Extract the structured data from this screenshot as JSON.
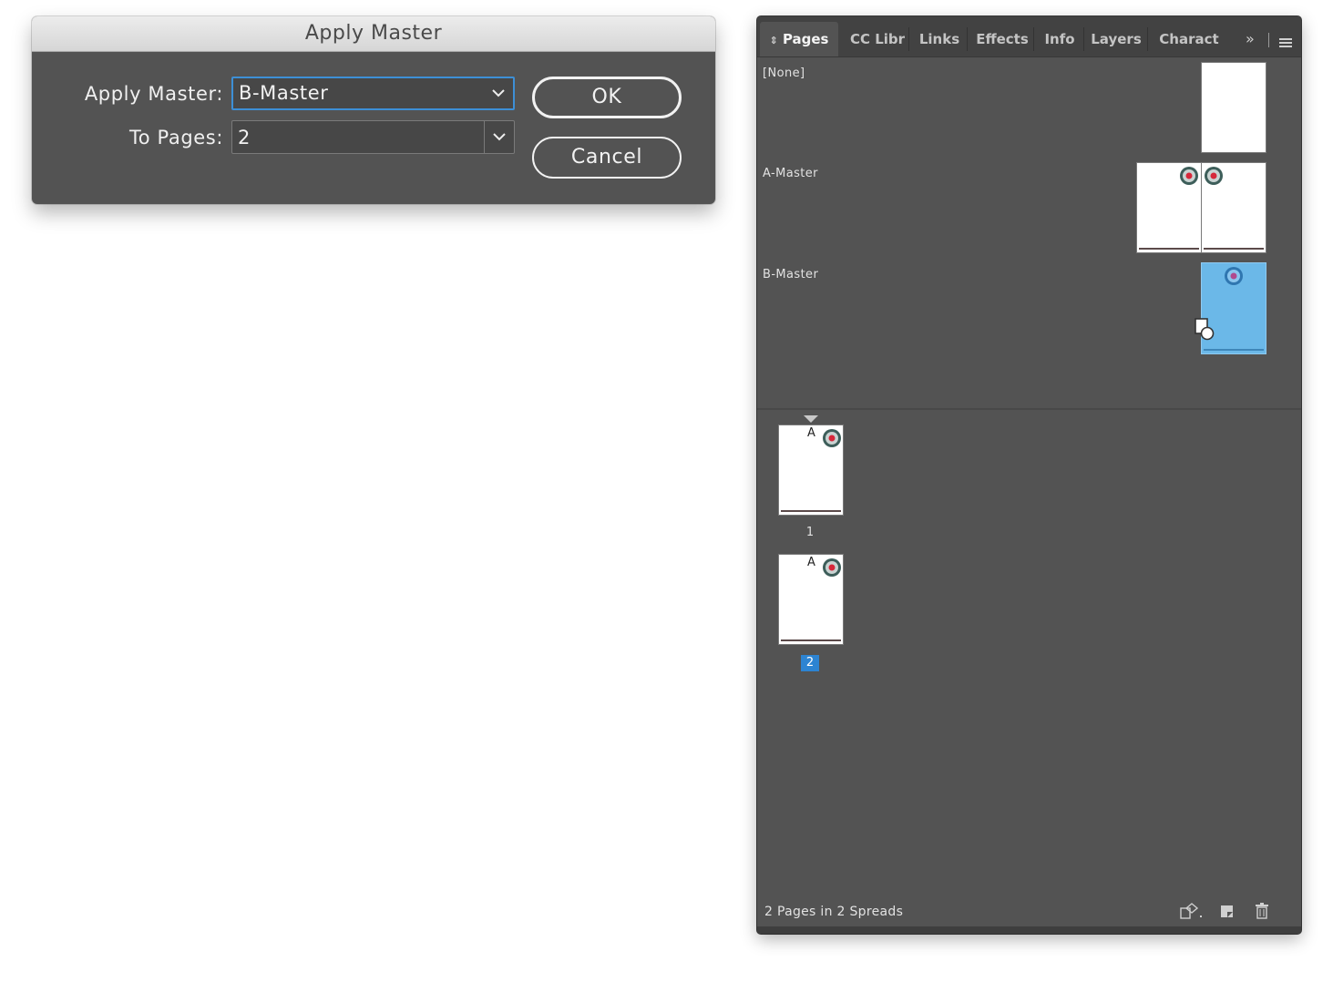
{
  "dialog": {
    "title": "Apply Master",
    "apply_master_label": "Apply Master:",
    "apply_master_value": "B-Master",
    "to_pages_label": "To Pages:",
    "to_pages_value": "2",
    "ok_label": "OK",
    "cancel_label": "Cancel"
  },
  "panel": {
    "tabs": [
      {
        "label": "Pages",
        "active": true
      },
      {
        "label": "CC Libr"
      },
      {
        "label": "Links"
      },
      {
        "label": "Effects"
      },
      {
        "label": "Info"
      },
      {
        "label": "Layers"
      },
      {
        "label": "Charact"
      }
    ],
    "overflow_glyph": "»",
    "masters": [
      {
        "label": "[None]"
      },
      {
        "label": "A-Master"
      },
      {
        "label": "B-Master"
      }
    ],
    "pages": [
      {
        "number": "1",
        "master_prefix": "A",
        "selected": false
      },
      {
        "number": "2",
        "master_prefix": "A",
        "selected": true
      }
    ],
    "status": "2 Pages in 2 Spreads"
  },
  "colors": {
    "panel_bg": "#535353",
    "selection_blue": "#2d84d2",
    "master_highlight": "#6bb8e8"
  }
}
